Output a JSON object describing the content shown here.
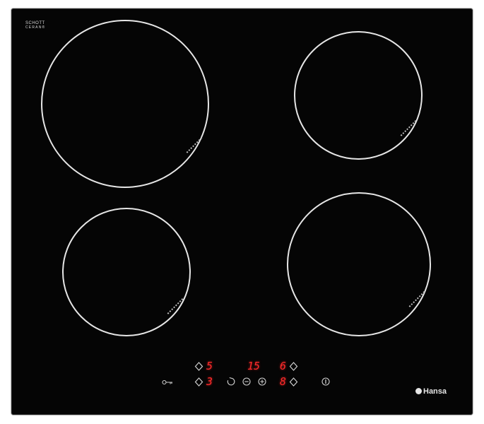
{
  "cooktop": {
    "brand_logo_line1": "SCHOTT",
    "brand_logo_line2": "CERAN®",
    "brand_name": "Hansa",
    "display": {
      "left_top": "5",
      "left_bottom": "3",
      "timer": "15",
      "right_top": "6",
      "right_bottom": "8"
    },
    "icons": {
      "lock": "key-icon",
      "timer": "timer-icon",
      "minus": "minus-icon",
      "plus": "plus-icon",
      "power": "power-icon",
      "zone_select": "zone-select-icon"
    },
    "colors": {
      "glass": "#050505",
      "zone_outline": "#e6e6e6",
      "display_red": "#ff2a2a"
    }
  }
}
